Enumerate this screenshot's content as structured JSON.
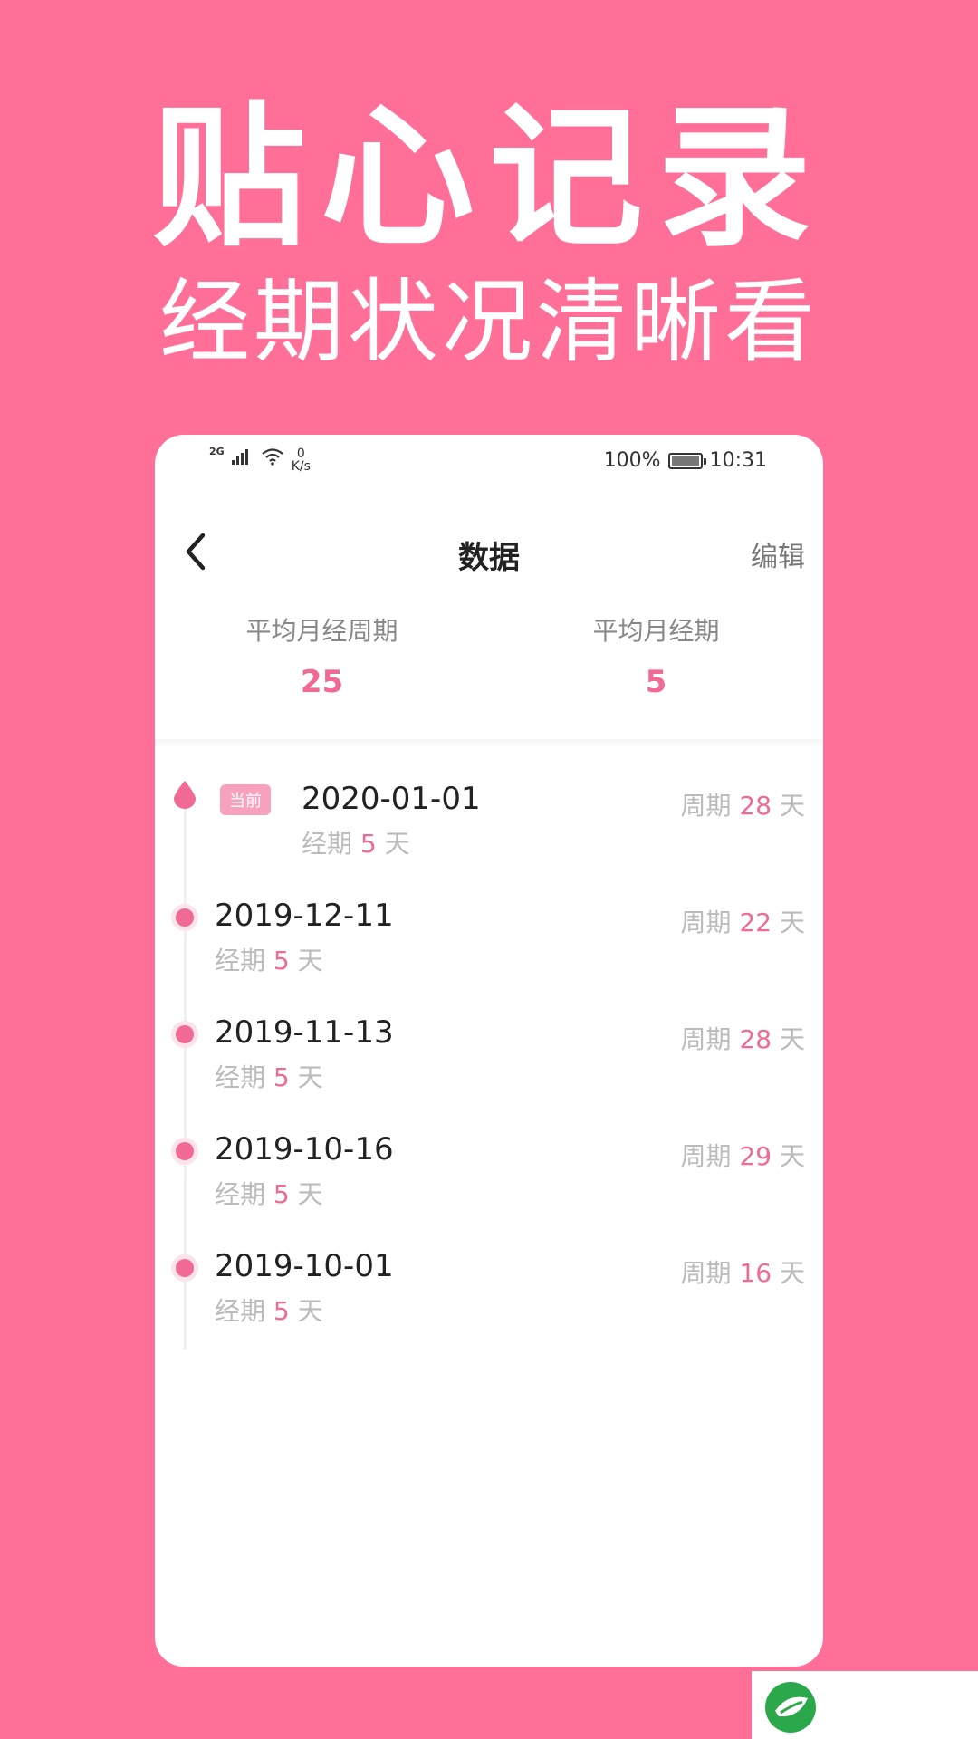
{
  "promo": {
    "headline": "贴心记录",
    "subhead": "经期状况清晰看"
  },
  "status_bar": {
    "network": "2G",
    "speed_value": "0",
    "speed_unit": "K/s",
    "battery": "100%",
    "time": "10:31"
  },
  "nav": {
    "title": "数据",
    "edit": "编辑"
  },
  "stats": {
    "avg_cycle_label": "平均月经周期",
    "avg_cycle_value": "25",
    "avg_period_label": "平均月经期",
    "avg_period_value": "5"
  },
  "labels": {
    "current": "当前",
    "period_prefix": "经期",
    "cycle_prefix": "周期",
    "day_unit": "天"
  },
  "records": [
    {
      "date": "2020-01-01",
      "period_days": "5",
      "cycle_days": "28"
    },
    {
      "date": "2019-12-11",
      "period_days": "5",
      "cycle_days": "22"
    },
    {
      "date": "2019-11-13",
      "period_days": "5",
      "cycle_days": "28"
    },
    {
      "date": "2019-10-16",
      "period_days": "5",
      "cycle_days": "29"
    },
    {
      "date": "2019-10-01",
      "period_days": "5",
      "cycle_days": "16"
    }
  ],
  "colors": {
    "background": "#FF6F98",
    "accent": "#F06A94",
    "badge": "#F7A1BC"
  }
}
